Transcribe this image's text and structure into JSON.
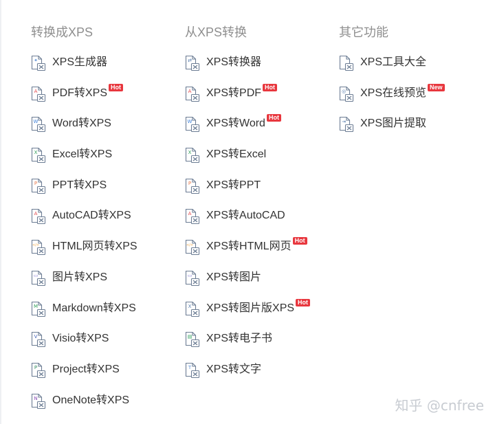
{
  "columns": [
    {
      "title": "转换成XPS",
      "items": [
        {
          "label": "XPS生成器",
          "icon": "xps-generator-icon",
          "color": "#5b8fd6",
          "glyph": "✦",
          "badge": ""
        },
        {
          "label": "PDF转XPS",
          "icon": "pdf-file-icon",
          "color": "#e4484d",
          "glyph": "A",
          "badge": "Hot"
        },
        {
          "label": "Word转XPS",
          "icon": "word-file-icon",
          "color": "#3d7fd9",
          "glyph": "W",
          "badge": ""
        },
        {
          "label": "Excel转XPS",
          "icon": "excel-file-icon",
          "color": "#2f9e5a",
          "glyph": "X",
          "badge": ""
        },
        {
          "label": "PPT转XPS",
          "icon": "ppt-file-icon",
          "color": "#e8774a",
          "glyph": "P",
          "badge": ""
        },
        {
          "label": "AutoCAD转XPS",
          "icon": "autocad-file-icon",
          "color": "#e4484d",
          "glyph": "A",
          "badge": ""
        },
        {
          "label": "HTML网页转XPS",
          "icon": "html-file-icon",
          "color": "#f0a23a",
          "glyph": "</>",
          "badge": ""
        },
        {
          "label": "图片转XPS",
          "icon": "image-file-icon",
          "color": "#8a7fd6",
          "glyph": "▭",
          "badge": ""
        },
        {
          "label": "Markdown转XPS",
          "icon": "markdown-file-icon",
          "color": "#2f9e5a",
          "glyph": "M",
          "badge": ""
        },
        {
          "label": "Visio转XPS",
          "icon": "visio-file-icon",
          "color": "#3d5fb8",
          "glyph": "V",
          "badge": ""
        },
        {
          "label": "Project转XPS",
          "icon": "project-file-icon",
          "color": "#2f8a5a",
          "glyph": "P",
          "badge": ""
        },
        {
          "label": "OneNote转XPS",
          "icon": "onenote-file-icon",
          "color": "#8a4fb8",
          "glyph": "N",
          "badge": ""
        }
      ]
    },
    {
      "title": "从XPS转换",
      "items": [
        {
          "label": "XPS转换器",
          "icon": "xps-converter-icon",
          "color": "#5a7fb0",
          "glyph": "⇄",
          "badge": ""
        },
        {
          "label": "XPS转PDF",
          "icon": "xps-to-pdf-icon",
          "color": "#e4484d",
          "glyph": "A",
          "badge": "Hot"
        },
        {
          "label": "XPS转Word",
          "icon": "xps-to-word-icon",
          "color": "#3d7fd9",
          "glyph": "W",
          "badge": "Hot"
        },
        {
          "label": "XPS转Excel",
          "icon": "xps-to-excel-icon",
          "color": "#2f9e5a",
          "glyph": "X",
          "badge": ""
        },
        {
          "label": "XPS转PPT",
          "icon": "xps-to-ppt-icon",
          "color": "#e8774a",
          "glyph": "P",
          "badge": ""
        },
        {
          "label": "XPS转AutoCAD",
          "icon": "xps-to-autocad-icon",
          "color": "#e4484d",
          "glyph": "A",
          "badge": ""
        },
        {
          "label": "XPS转HTML网页",
          "icon": "xps-to-html-icon",
          "color": "#f0a23a",
          "glyph": "</>",
          "badge": "Hot"
        },
        {
          "label": "XPS转图片",
          "icon": "xps-to-image-icon",
          "color": "#8a7fd6",
          "glyph": "▭",
          "badge": ""
        },
        {
          "label": "XPS转图片版XPS",
          "icon": "xps-to-image-xps-icon",
          "color": "#5a7fb0",
          "glyph": "X",
          "badge": "Hot"
        },
        {
          "label": "XPS转电子书",
          "icon": "xps-to-ebook-icon",
          "color": "#2f9e5a",
          "glyph": "▤",
          "badge": ""
        },
        {
          "label": "XPS转文字",
          "icon": "xps-to-text-icon",
          "color": "#5b8fd6",
          "glyph": "T",
          "badge": ""
        }
      ]
    },
    {
      "title": "其它功能",
      "items": [
        {
          "label": "XPS工具大全",
          "icon": "xps-toolbox-icon",
          "color": "#5a7fb0",
          "glyph": "",
          "badge": ""
        },
        {
          "label": "XPS在线预览",
          "icon": "xps-preview-icon",
          "color": "#5a7fb0",
          "glyph": "◎",
          "badge": "New"
        },
        {
          "label": "XPS图片提取",
          "icon": "xps-image-extract-icon",
          "color": "#5a7fb0",
          "glyph": "⇥",
          "badge": ""
        }
      ]
    }
  ],
  "watermark": "知乎 @cnfree",
  "colors": {
    "badge": "#e8373e",
    "title": "#8f8f8f",
    "text": "#333333",
    "icon_base": "#6b7c93"
  }
}
